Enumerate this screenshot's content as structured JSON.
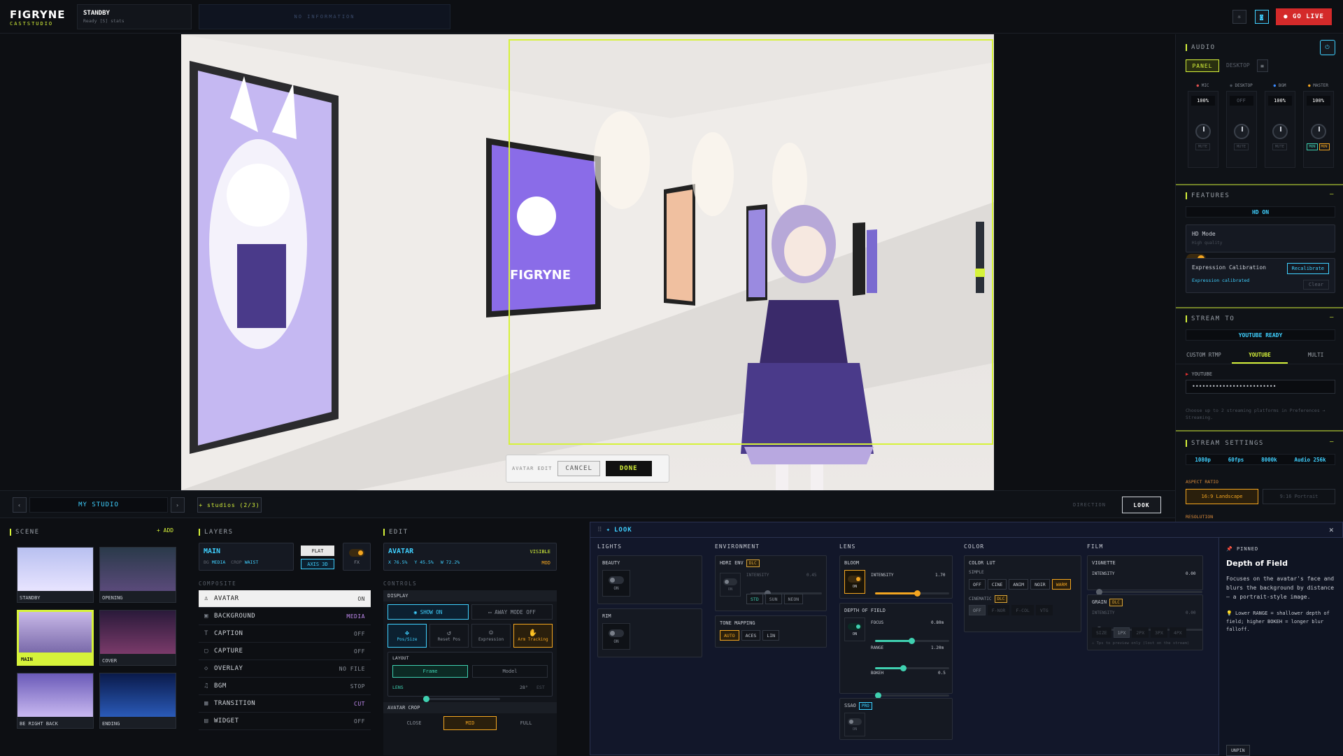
{
  "app": {
    "logo": "FIGRYNE",
    "logo_sub": "CASTSTUDIO",
    "status_title": "STANDBY",
    "status_sub": "Ready [S] stats",
    "info": "NO INFORMATION",
    "go_live": "● GO LIVE"
  },
  "preview": {
    "poster_text": "FIGRYNE",
    "edit_label": "AVATAR EDIT",
    "cancel": "CANCEL",
    "done": "DONE"
  },
  "studio": {
    "title": "MY STUDIO",
    "studios": "+ studios (2/3)",
    "direction": "DIRECTION",
    "look_btn": "LOOK"
  },
  "scene": {
    "title": "SCENE",
    "add": "+ ADD",
    "items": [
      "STANDBY",
      "OPENING",
      "MAIN",
      "COVER",
      "BE RIGHT BACK",
      "ENDING"
    ]
  },
  "layers": {
    "title": "LAYERS",
    "main": "MAIN",
    "bg": "BG",
    "bg_val": "MEDIA",
    "crop": "CROP",
    "crop_val": "WAIST",
    "flat": "FLAT",
    "axis": "AXIS 3D",
    "fx": "FX",
    "composite": "COMPOSITE",
    "list": [
      {
        "icon": "♙",
        "name": "AVATAR",
        "state": "ON"
      },
      {
        "icon": "▣",
        "name": "BACKGROUND",
        "state": "MEDIA"
      },
      {
        "icon": "T",
        "name": "CAPTION",
        "state": "OFF"
      },
      {
        "icon": "▢",
        "name": "CAPTURE",
        "state": "OFF"
      },
      {
        "icon": "◇",
        "name": "OVERLAY",
        "state": "NO FILE"
      },
      {
        "icon": "♫",
        "name": "BGM",
        "state": "STOP"
      },
      {
        "icon": "▦",
        "name": "TRANSITION",
        "state": "CUT"
      },
      {
        "icon": "▤",
        "name": "WIDGET",
        "state": "OFF"
      }
    ]
  },
  "edit": {
    "title": "EDIT",
    "avatar": "AVATAR",
    "visible": "VISIBLE",
    "x": "X 76.5%",
    "y": "Y 45.5%",
    "w": "W 72.2%",
    "mod": "MOD",
    "controls": "CONTROLS",
    "display": "DISPLAY",
    "show_on": "SHOW ON",
    "away": "AWAY MODE OFF",
    "tools": [
      "Pos/Size",
      "Reset Pos",
      "Expression",
      "Arm Tracking"
    ],
    "layout": "LAYOUT",
    "frame": "Frame",
    "model": "Model",
    "lens": "LENS",
    "lens_val": "28°",
    "est": "EST",
    "crop": "AVATAR CROP",
    "crop_opts": [
      "CLOSE",
      "MID",
      "FULL"
    ]
  },
  "look": {
    "title": "LOOK",
    "lights": {
      "title": "LIGHTS",
      "beauty": "BEAUTY",
      "rim": "RIM",
      "on": "ON"
    },
    "env": {
      "title": "ENVIRONMENT",
      "hdri": "HDRI ENV",
      "dlc": "DLC",
      "intensity": "INTENSITY",
      "int_val": "0.45",
      "opts": [
        "STD",
        "SUN",
        "NEON"
      ],
      "tone": "TONE MAPPING",
      "tone_opts": [
        "AUTO",
        "ACES",
        "LIN"
      ]
    },
    "lens": {
      "title": "LENS",
      "bloom": "BLOOM",
      "intensity": "INTENSITY",
      "bloom_val": "1.70",
      "dof": "DEPTH OF FIELD",
      "focus": "FOCUS",
      "focus_val": "0.80m",
      "range": "RANGE",
      "range_val": "1.20m",
      "bokeh": "BOKEH",
      "bokeh_val": "0.5",
      "ssao": "SSAO",
      "pro": "PRO",
      "on": "ON"
    },
    "color": {
      "title": "COLOR",
      "lut": "COLOR LUT",
      "simple": "SIMPLE",
      "opts": [
        "OFF",
        "CINE",
        "ANIM",
        "NOIR",
        "WARM"
      ],
      "cine": "CINEMATIC",
      "cine_opts": [
        "OFF",
        "F-NOR",
        "F-COL",
        "VTG"
      ]
    },
    "film": {
      "title": "FILM",
      "vignette": "VIGNETTE",
      "intensity": "INTENSITY",
      "vig_val": "0.00",
      "grain": "GRAIN",
      "grain_val": "0.00",
      "sizes": [
        "SIZE",
        "1PX",
        "2PX",
        "3PX",
        "4PX"
      ],
      "tip": "Tps to preview only (lost on the stream)"
    },
    "pinned": {
      "label": "PINNED",
      "title": "Depth of Field",
      "desc": "Focuses on the avatar's face and blurs the background by distance — a portrait-style image.",
      "tip": "Lower RANGE = shallower depth of field; higher BOKEH = longer blur falloff.",
      "unpin": "UNPIN"
    }
  },
  "audio": {
    "title": "AUDIO",
    "panel": "PANEL",
    "desktop": "DESKTOP",
    "channels": [
      {
        "name": "MIC",
        "val": "100%",
        "btn": "MUTE"
      },
      {
        "name": "DESKTOP",
        "val": "OFF",
        "btn": "MUTE"
      },
      {
        "name": "BGM",
        "val": "100%",
        "btn": "MUTE"
      },
      {
        "name": "MASTER",
        "val": "100%",
        "btn": "MON"
      }
    ]
  },
  "features": {
    "title": "FEATURES",
    "status": "HD ON",
    "hd": "HD Mode",
    "hd_sub": "High quality",
    "expr": "Expression Calibration",
    "recal": "Recalibrate",
    "calibrated": "Expression calibrated",
    "clear": "Clear"
  },
  "stream": {
    "title": "STREAM TO",
    "status": "YOUTUBE READY",
    "tabs": [
      "CUSTOM RTMP",
      "YOUTUBE",
      "MULTI"
    ],
    "yt_label": "YOUTUBE",
    "key": "•••••••••••••••••••••••••",
    "note": "Choose up to 2 streaming platforms in Preferences → Streaming."
  },
  "settings": {
    "title": "STREAM SETTINGS",
    "vals": [
      "1080p",
      "60fps",
      "8000k",
      "Audio 256k"
    ],
    "aspect": "ASPECT RATIO",
    "landscape": "16:9 Landscape",
    "portrait": "9:16 Portrait",
    "resolution": "RESOLUTION"
  }
}
